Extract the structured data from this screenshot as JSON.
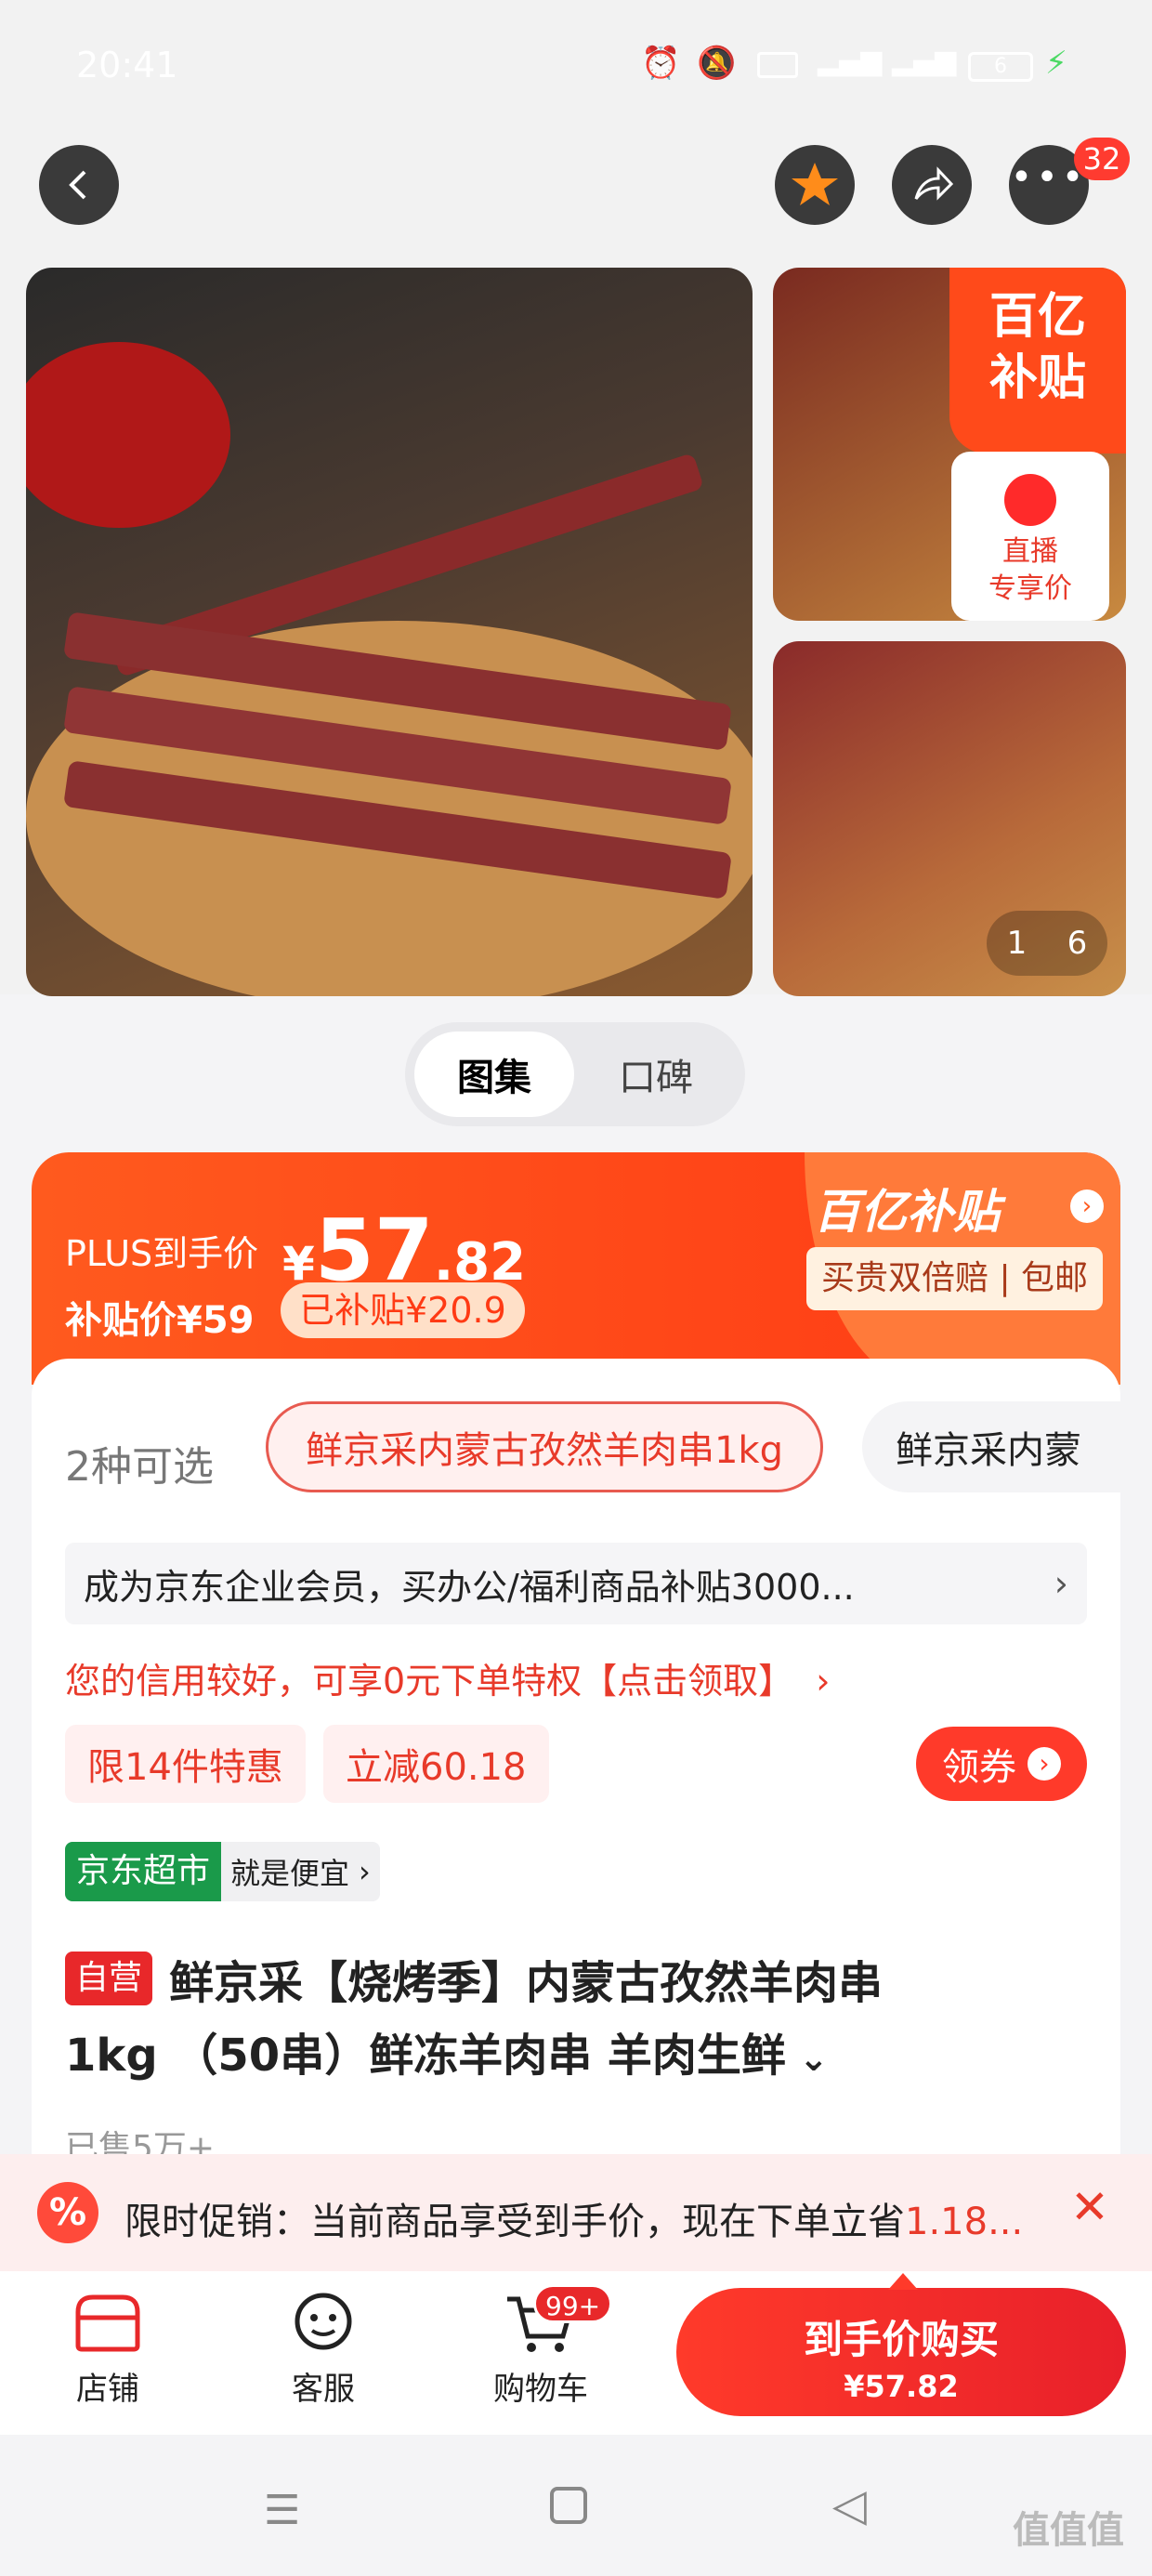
{
  "status_bar": {
    "time": "20:41",
    "battery": "6"
  },
  "header": {
    "badge_count": "32"
  },
  "gallery": {
    "yi_badge_line1": "百亿",
    "yi_badge_line2": "补贴",
    "live_label": "直播\n专享价",
    "counter_current": "1",
    "counter_total": "6"
  },
  "tabs": [
    "图集",
    "口碑"
  ],
  "price": {
    "plus_label": "PLUS到手价",
    "currency": "¥",
    "int": "57",
    "dec": ".82",
    "subsidy_price_label": "补贴价¥59",
    "subsidized": "已补贴¥20.9",
    "brand": "百亿补贴",
    "guarantee": "买贵双倍赔 | 包邮"
  },
  "sku": {
    "count_label": "2种可选",
    "options": [
      "鲜京采内蒙古孜然羊肉串1kg",
      "鲜京采内蒙"
    ]
  },
  "promo": {
    "enterprise": "成为京东企业会员，买办公/福利商品补贴3000...",
    "credit": "您的信用较好，可享0元下单特权【点击领取】",
    "limit_tag": "限14件特惠",
    "reduce_tag": "立减60.18",
    "coupon_btn": "领券"
  },
  "supermarket": {
    "badge": "京东超市",
    "slogan": "就是便宜"
  },
  "product": {
    "self_tag": "自营",
    "title_line1": "鲜京采【烧烤季】内蒙古孜然羊肉串",
    "title_line2": "1kg （50串）鲜冻羊肉串 羊肉生鲜",
    "sold": "已售5万+"
  },
  "flash": {
    "text": "限时促销：当前商品享受到手价，现在下单立省",
    "amount": "1.18..."
  },
  "bottom_nav": {
    "store": "店铺",
    "service": "客服",
    "cart": "购物车",
    "cart_badge": "99+",
    "buy_title": "到手价购买",
    "buy_price": "¥57.82"
  },
  "watermark": "值值值"
}
